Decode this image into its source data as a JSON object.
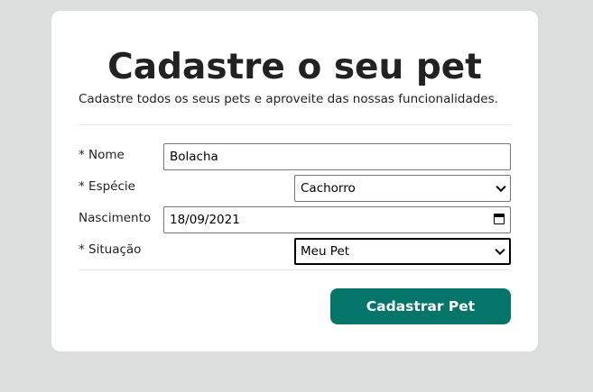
{
  "form": {
    "title": "Cadastre o seu pet",
    "subtitle": "Cadastre todos os seus pets e aproveite das nossas funcionalidades.",
    "fields": {
      "nome": {
        "label": "* Nome",
        "value": "Bolacha"
      },
      "especie": {
        "label": "* Espécie",
        "value": "Cachorro"
      },
      "nascimento": {
        "label": "Nascimento",
        "value": "18/09/2021"
      },
      "situacao": {
        "label": "* Situação",
        "value": "Meu Pet"
      }
    },
    "submit_label": "Cadastrar Pet"
  },
  "colors": {
    "background": "#dcdedd",
    "card": "#ffffff",
    "button": "#05756a",
    "button_text": "#ffffff"
  },
  "icons": {
    "select_arrow": "chevron-down-icon",
    "date_picker": "calendar-icon"
  }
}
